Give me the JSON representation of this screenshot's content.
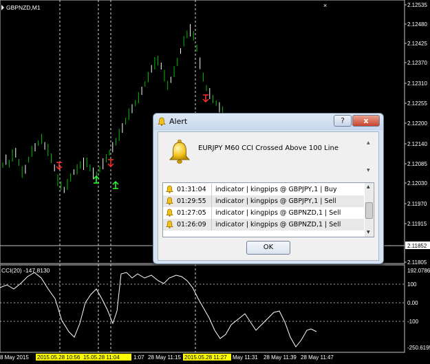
{
  "chart": {
    "symbol_label": "GBPNZD,M1",
    "price_labels": [
      "2.12535",
      "2.12480",
      "2.12425",
      "2.12370",
      "2.12310",
      "2.12255",
      "2.12200",
      "2.12140",
      "2.12085",
      "2.12030",
      "2.11970",
      "2.11915",
      "2.11852",
      "2.11805"
    ],
    "current_price": "2.11852",
    "indicator_label": "CCI(20) -147.8130",
    "indicator_scale": [
      "192.0786",
      "100",
      "0.00",
      "-100",
      "-250.6195"
    ],
    "time_labels": [
      "8 May 2015",
      "2015.05.28 10:56",
      "15.05.28 11:04",
      "1:07",
      "28 May 11:15",
      "2015.05.28 11:27",
      "May 11:31",
      "28 May 11:39",
      "28 May 11:47"
    ]
  },
  "alert": {
    "title": "Alert",
    "help_button": "?",
    "close_button": "x",
    "message": "EURJPY M60 CCI Crossed Above 100 Line",
    "rows": [
      {
        "time": "01:31:04",
        "text": "indicator | kingpips @ GBPJPY,1 | Buy"
      },
      {
        "time": "01:29:55",
        "text": "indicator | kingpips @ GBPJPY,1 | Sell"
      },
      {
        "time": "01:27:05",
        "text": "indicator | kingpips @ GBPNZD,1 | Sell"
      },
      {
        "time": "01:26:09",
        "text": "indicator | kingpips @ GBPNZD,1 | Sell"
      }
    ],
    "ok_label": "OK"
  },
  "colors": {
    "background": "#000000",
    "bull_candle": "#00c000",
    "bear_candle": "#ffffff",
    "cci_line": "#ffffff",
    "highlight": "#ffff00",
    "sell_arrow": "#ff3030",
    "buy_arrow": "#30ff30"
  },
  "icons": [
    "bell-icon",
    "sell-arrow-icon",
    "buy-arrow-icon",
    "help-icon",
    "close-icon"
  ]
}
